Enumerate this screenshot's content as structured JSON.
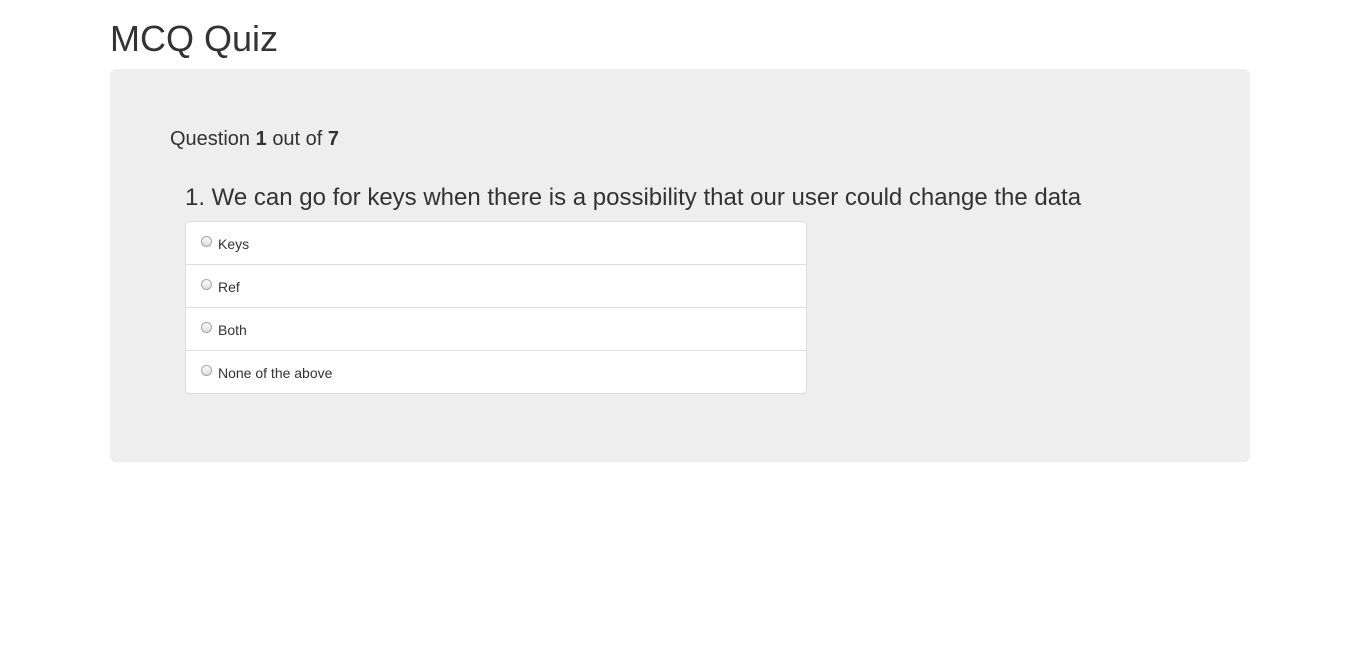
{
  "header": {
    "title": "MCQ Quiz"
  },
  "progress": {
    "prefix": "Question",
    "current": "1",
    "middle": "out of",
    "total": "7"
  },
  "question": {
    "text": "1. We can go for keys when there is a possibility that our user could change the data"
  },
  "options": [
    {
      "label": "Keys",
      "selected": false
    },
    {
      "label": "Ref",
      "selected": false
    },
    {
      "label": "Both",
      "selected": false
    },
    {
      "label": "None of the above",
      "selected": false
    }
  ]
}
